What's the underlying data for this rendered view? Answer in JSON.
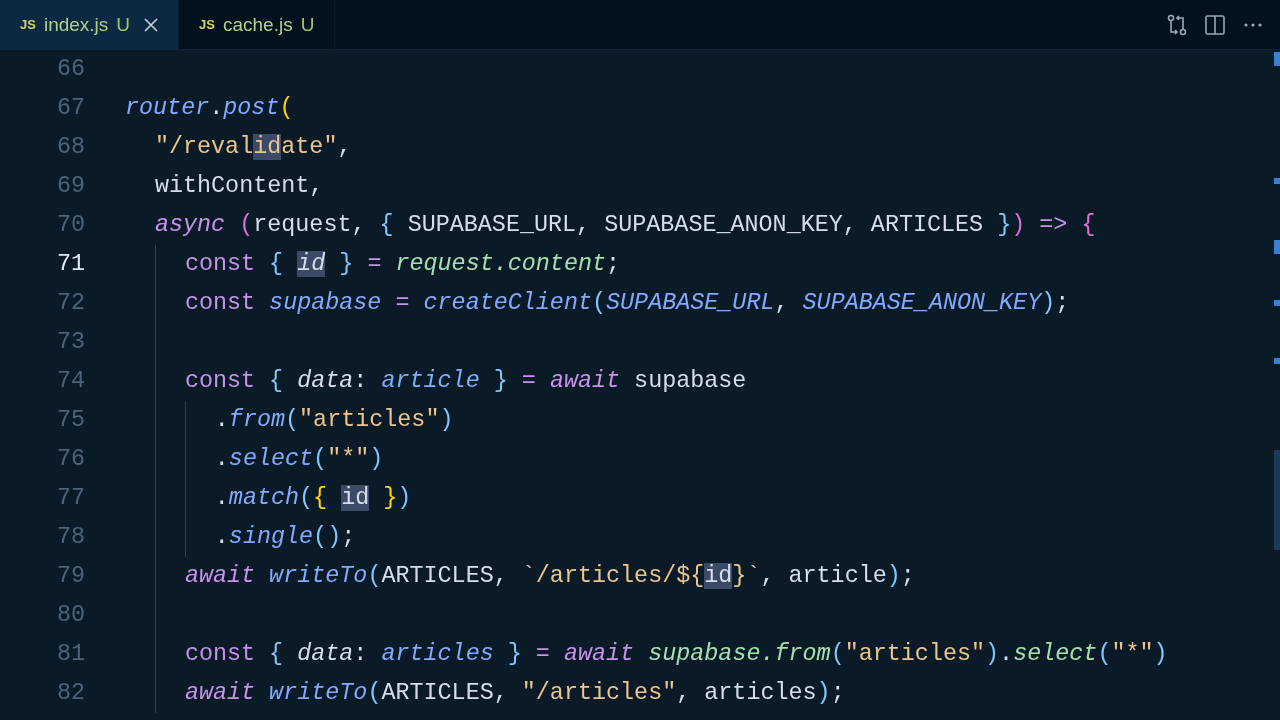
{
  "tabs": [
    {
      "icon_text": "JS",
      "label": "index.js",
      "badge": "U",
      "selected": true
    },
    {
      "icon_text": "JS",
      "label": "cache.js",
      "badge": "U",
      "selected": false
    }
  ],
  "editor": {
    "lines": [
      {
        "number": "66",
        "active": false
      },
      {
        "number": "67",
        "active": false,
        "tokens": [
          {
            "text": "router",
            "kind": "fn"
          },
          {
            "text": ".",
            "kind": "punct"
          },
          {
            "text": "post",
            "kind": "fn"
          },
          {
            "text": "(",
            "kind": "p1"
          }
        ],
        "children": [
          {
            "number": "68",
            "active": false,
            "tokens": [
              {
                "text": "\"/reval",
                "kind": "str"
              },
              {
                "text": "id",
                "kind": "str",
                "highlight": true
              },
              {
                "text": "ate\"",
                "kind": "str"
              },
              {
                "text": ",",
                "kind": "punct"
              }
            ]
          },
          {
            "number": "69",
            "active": false,
            "tokens": [
              {
                "text": "withContent,",
                "kind": "var"
              }
            ]
          },
          {
            "number": "70",
            "active": false,
            "tokens": [
              {
                "text": "async ",
                "kind": "kwi"
              },
              {
                "text": "(",
                "kind": "p2"
              },
              {
                "text": "request, ",
                "kind": "var"
              },
              {
                "text": "{",
                "kind": "p3"
              },
              {
                "text": " SUPABASE_URL, SUPABASE_ANON_KEY, ARTICLES ",
                "kind": "var"
              },
              {
                "text": "}",
                "kind": "p3"
              },
              {
                "text": ")",
                "kind": "p2"
              },
              {
                "text": " => ",
                "kind": "op"
              },
              {
                "text": "{",
                "kind": "p2"
              }
            ],
            "children": [
              {
                "number": "71",
                "active": true,
                "tokens": [
                  {
                    "text": "const ",
                    "kind": "kw"
                  },
                  {
                    "text": "{ ",
                    "kind": "p3"
                  },
                  {
                    "text": "id",
                    "kind": "vari",
                    "highlight": true
                  },
                  {
                    "text": " }",
                    "kind": "p3"
                  },
                  {
                    "text": " = ",
                    "kind": "op"
                  },
                  {
                    "text": "request.content",
                    "kind": "green"
                  },
                  {
                    "text": ";",
                    "kind": "punct"
                  }
                ]
              },
              {
                "number": "72",
                "active": false,
                "tokens": [
                  {
                    "text": "const ",
                    "kind": "kw"
                  },
                  {
                    "text": "supabase",
                    "kind": "fn"
                  },
                  {
                    "text": " = ",
                    "kind": "op"
                  },
                  {
                    "text": "createClient",
                    "kind": "fn"
                  },
                  {
                    "text": "(",
                    "kind": "p3"
                  },
                  {
                    "text": "SUPABASE_URL",
                    "kind": "fn"
                  },
                  {
                    "text": ", ",
                    "kind": "punct"
                  },
                  {
                    "text": "SUPABASE_ANON_KEY",
                    "kind": "fn"
                  },
                  {
                    "text": ")",
                    "kind": "p3"
                  },
                  {
                    "text": ";",
                    "kind": "punct"
                  }
                ]
              },
              {
                "number": "73",
                "active": false
              },
              {
                "number": "74",
                "active": false,
                "tokens": [
                  {
                    "text": "const ",
                    "kind": "kw"
                  },
                  {
                    "text": "{ ",
                    "kind": "p3"
                  },
                  {
                    "text": "data",
                    "kind": "vari"
                  },
                  {
                    "text": ": ",
                    "kind": "punct"
                  },
                  {
                    "text": "article",
                    "kind": "fn"
                  },
                  {
                    "text": " }",
                    "kind": "p3"
                  },
                  {
                    "text": " = ",
                    "kind": "op"
                  },
                  {
                    "text": "await",
                    "kind": "kwi"
                  },
                  {
                    "text": " supabase",
                    "kind": "var"
                  }
                ],
                "children": [
                  {
                    "number": "75",
                    "active": false,
                    "tokens": [
                      {
                        "text": ".",
                        "kind": "punct"
                      },
                      {
                        "text": "from",
                        "kind": "fn"
                      },
                      {
                        "text": "(",
                        "kind": "p3"
                      },
                      {
                        "text": "\"articles\"",
                        "kind": "str"
                      },
                      {
                        "text": ")",
                        "kind": "p3"
                      }
                    ]
                  },
                  {
                    "number": "76",
                    "active": false,
                    "tokens": [
                      {
                        "text": ".",
                        "kind": "punct"
                      },
                      {
                        "text": "select",
                        "kind": "fn"
                      },
                      {
                        "text": "(",
                        "kind": "p3"
                      },
                      {
                        "text": "\"*\"",
                        "kind": "str"
                      },
                      {
                        "text": ")",
                        "kind": "p3"
                      }
                    ]
                  },
                  {
                    "number": "77",
                    "active": false,
                    "tokens": [
                      {
                        "text": ".",
                        "kind": "punct"
                      },
                      {
                        "text": "match",
                        "kind": "fn"
                      },
                      {
                        "text": "(",
                        "kind": "p3"
                      },
                      {
                        "text": "{ ",
                        "kind": "p1"
                      },
                      {
                        "text": "id",
                        "kind": "var",
                        "highlight": true
                      },
                      {
                        "text": " }",
                        "kind": "p1"
                      },
                      {
                        "text": ")",
                        "kind": "p3"
                      }
                    ]
                  },
                  {
                    "number": "78",
                    "active": false,
                    "tokens": [
                      {
                        "text": ".",
                        "kind": "punct"
                      },
                      {
                        "text": "single",
                        "kind": "fn"
                      },
                      {
                        "text": "()",
                        "kind": "p3"
                      },
                      {
                        "text": ";",
                        "kind": "punct"
                      }
                    ]
                  }
                ]
              },
              {
                "number": "79",
                "active": false,
                "tokens": [
                  {
                    "text": "await ",
                    "kind": "kwi"
                  },
                  {
                    "text": "writeTo",
                    "kind": "fn"
                  },
                  {
                    "text": "(",
                    "kind": "p3"
                  },
                  {
                    "text": "ARTICLES, ",
                    "kind": "var"
                  },
                  {
                    "text": "`/articles/${",
                    "kind": "str"
                  },
                  {
                    "text": "id",
                    "kind": "var",
                    "highlight": true
                  },
                  {
                    "text": "}`",
                    "kind": "str"
                  },
                  {
                    "text": ", article",
                    "kind": "var"
                  },
                  {
                    "text": ")",
                    "kind": "p3"
                  },
                  {
                    "text": ";",
                    "kind": "punct"
                  }
                ]
              },
              {
                "number": "80",
                "active": false
              },
              {
                "number": "81",
                "active": false,
                "tokens": [
                  {
                    "text": "const ",
                    "kind": "kw"
                  },
                  {
                    "text": "{ ",
                    "kind": "p3"
                  },
                  {
                    "text": "data",
                    "kind": "vari"
                  },
                  {
                    "text": ": ",
                    "kind": "punct"
                  },
                  {
                    "text": "articles",
                    "kind": "fn"
                  },
                  {
                    "text": " }",
                    "kind": "p3"
                  },
                  {
                    "text": " = ",
                    "kind": "op"
                  },
                  {
                    "text": "await ",
                    "kind": "kwi"
                  },
                  {
                    "text": "supabase.from",
                    "kind": "green"
                  },
                  {
                    "text": "(",
                    "kind": "p3"
                  },
                  {
                    "text": "\"articles\"",
                    "kind": "str"
                  },
                  {
                    "text": ")",
                    "kind": "p3"
                  },
                  {
                    "text": ".",
                    "kind": "punct"
                  },
                  {
                    "text": "select",
                    "kind": "green"
                  },
                  {
                    "text": "(",
                    "kind": "p3"
                  },
                  {
                    "text": "\"*\"",
                    "kind": "str"
                  },
                  {
                    "text": ")",
                    "kind": "p3"
                  }
                ]
              },
              {
                "number": "82",
                "active": false,
                "tokens": [
                  {
                    "text": "await ",
                    "kind": "kwi"
                  },
                  {
                    "text": "writeTo",
                    "kind": "fn"
                  },
                  {
                    "text": "(",
                    "kind": "p3"
                  },
                  {
                    "text": "ARTICLES, ",
                    "kind": "var"
                  },
                  {
                    "text": "\"/articles\"",
                    "kind": "str"
                  },
                  {
                    "text": ", articles",
                    "kind": "var"
                  },
                  {
                    "text": ")",
                    "kind": "p3"
                  },
                  {
                    "text": ";",
                    "kind": "punct"
                  }
                ]
              }
            ]
          }
        ]
      }
    ]
  }
}
